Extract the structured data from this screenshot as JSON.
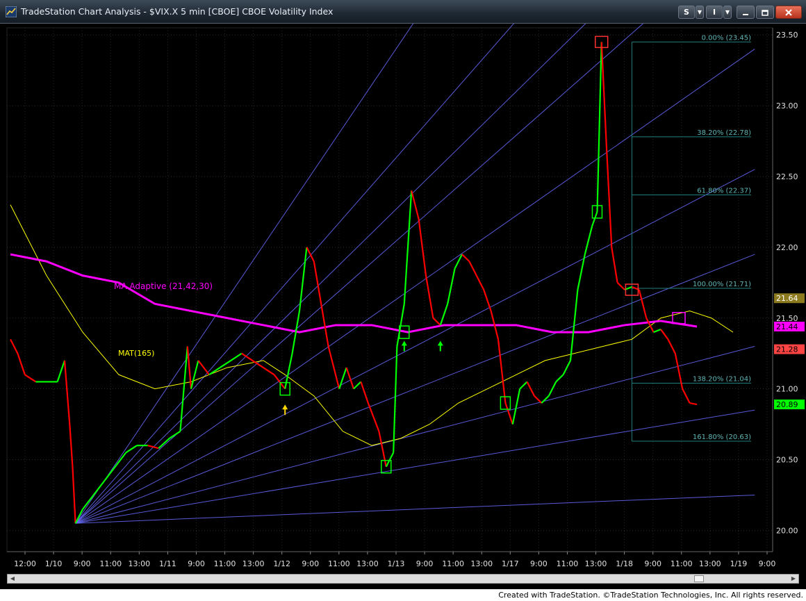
{
  "window": {
    "title": "TradeStation Chart Analysis - $VIX.X 5 min [CBOE] CBOE Volatility Index",
    "buttons": {
      "s_label": "S",
      "i_label": "I"
    },
    "icons": [
      "app-icon",
      "dropdown-arrow-icon",
      "minimize-icon",
      "restore-icon",
      "close-icon"
    ]
  },
  "footer": {
    "credit": "Created with TradeStation. ©TradeStation Technologies, Inc. All rights reserved."
  },
  "colors": {
    "bg": "#000000",
    "up": "#00ff00",
    "down": "#ff0000",
    "ma_adaptive": "#ff00ff",
    "mat": "#ffff00",
    "fan": "#6a6aff",
    "fib": "#1f7f7f"
  },
  "chart_data": {
    "type": "line",
    "symbol": "$VIX.X 5 min [CBOE]",
    "y_ticks": [
      "23.50",
      "23.00",
      "22.50",
      "22.00",
      "21.50",
      "21.00",
      "20.50",
      "20.00"
    ],
    "ylim": [
      19.85,
      23.55
    ],
    "x_ticks": [
      "12:00",
      "1/10",
      "9:00",
      "11:00",
      "13:00",
      "1/11",
      "9:00",
      "11:00",
      "13:00",
      "1/12",
      "9:00",
      "11:00",
      "13:00",
      "1/13",
      "9:00",
      "11:00",
      "13:00",
      "1/17",
      "9:00",
      "11:00",
      "13:00",
      "1/18",
      "9:00",
      "11:00",
      "13:00",
      "1/19",
      "9:00"
    ],
    "indicators": [
      {
        "name": "MA Adaptive (21,42,30)",
        "color": "#ff00ff",
        "last": "21.44"
      },
      {
        "name": "MAT(165)",
        "color": "#ffff00",
        "last": "21.64"
      }
    ],
    "price_labels": [
      {
        "value": "21.64",
        "bg": "#8c7a1e",
        "fg": "#ffffff"
      },
      {
        "value": "21.44",
        "bg": "#ff00ff",
        "fg": "#000000"
      },
      {
        "value": "21.28",
        "bg": "#ff4444",
        "fg": "#000000"
      },
      {
        "value": "20.89",
        "bg": "#00ff00",
        "fg": "#000000"
      }
    ],
    "fib_levels": [
      {
        "label": "0.00% (23.45)",
        "price": 23.45
      },
      {
        "label": "38.20% (22.78)",
        "price": 22.78
      },
      {
        "label": "61.80% (22.37)",
        "price": 22.37
      },
      {
        "label": "100.00% (21.71)",
        "price": 21.71
      },
      {
        "label": "138.20% (21.04)",
        "price": 21.04
      },
      {
        "label": "161.80% (20.63)",
        "price": 20.63
      }
    ],
    "price_path": [
      [
        0,
        21.35
      ],
      [
        0.01,
        21.25
      ],
      [
        0.02,
        21.1
      ],
      [
        0.035,
        21.05
      ],
      [
        0.05,
        21.05
      ],
      [
        0.065,
        21.05
      ],
      [
        0.075,
        21.2
      ],
      [
        0.082,
        20.75
      ],
      [
        0.086,
        20.45
      ],
      [
        0.09,
        20.05
      ],
      [
        0.1,
        20.15
      ],
      [
        0.115,
        20.25
      ],
      [
        0.13,
        20.35
      ],
      [
        0.145,
        20.45
      ],
      [
        0.16,
        20.55
      ],
      [
        0.175,
        20.6
      ],
      [
        0.19,
        20.6
      ],
      [
        0.205,
        20.58
      ],
      [
        0.22,
        20.65
      ],
      [
        0.235,
        20.7
      ],
      [
        0.245,
        21.3
      ],
      [
        0.25,
        21.0
      ],
      [
        0.26,
        21.2
      ],
      [
        0.275,
        21.1
      ],
      [
        0.29,
        21.15
      ],
      [
        0.305,
        21.2
      ],
      [
        0.32,
        21.25
      ],
      [
        0.335,
        21.2
      ],
      [
        0.35,
        21.15
      ],
      [
        0.365,
        21.1
      ],
      [
        0.38,
        21.0
      ],
      [
        0.39,
        21.25
      ],
      [
        0.4,
        21.55
      ],
      [
        0.41,
        22.0
      ],
      [
        0.42,
        21.9
      ],
      [
        0.43,
        21.6
      ],
      [
        0.44,
        21.3
      ],
      [
        0.455,
        21.0
      ],
      [
        0.465,
        21.15
      ],
      [
        0.475,
        21.0
      ],
      [
        0.485,
        21.05
      ],
      [
        0.495,
        20.9
      ],
      [
        0.51,
        20.7
      ],
      [
        0.52,
        20.45
      ],
      [
        0.53,
        20.55
      ],
      [
        0.535,
        21.3
      ],
      [
        0.545,
        21.6
      ],
      [
        0.555,
        22.4
      ],
      [
        0.565,
        22.2
      ],
      [
        0.575,
        21.8
      ],
      [
        0.585,
        21.5
      ],
      [
        0.595,
        21.45
      ],
      [
        0.605,
        21.6
      ],
      [
        0.615,
        21.85
      ],
      [
        0.625,
        21.95
      ],
      [
        0.635,
        21.9
      ],
      [
        0.645,
        21.8
      ],
      [
        0.655,
        21.7
      ],
      [
        0.665,
        21.55
      ],
      [
        0.675,
        21.35
      ],
      [
        0.685,
        20.9
      ],
      [
        0.695,
        20.75
      ],
      [
        0.705,
        21.0
      ],
      [
        0.715,
        21.05
      ],
      [
        0.725,
        20.95
      ],
      [
        0.735,
        20.9
      ],
      [
        0.745,
        20.95
      ],
      [
        0.755,
        21.05
      ],
      [
        0.765,
        21.1
      ],
      [
        0.775,
        21.2
      ],
      [
        0.785,
        21.7
      ],
      [
        0.795,
        21.95
      ],
      [
        0.805,
        22.15
      ],
      [
        0.812,
        22.25
      ],
      [
        0.818,
        23.45
      ],
      [
        0.825,
        22.7
      ],
      [
        0.832,
        22.0
      ],
      [
        0.84,
        21.75
      ],
      [
        0.85,
        21.7
      ],
      [
        0.86,
        21.72
      ],
      [
        0.87,
        21.7
      ],
      [
        0.88,
        21.5
      ],
      [
        0.89,
        21.4
      ],
      [
        0.9,
        21.42
      ],
      [
        0.91,
        21.35
      ],
      [
        0.92,
        21.25
      ],
      [
        0.93,
        21.0
      ],
      [
        0.94,
        20.9
      ],
      [
        0.95,
        20.89
      ]
    ],
    "mat_path": [
      [
        0,
        22.3
      ],
      [
        0.05,
        21.8
      ],
      [
        0.1,
        21.4
      ],
      [
        0.15,
        21.1
      ],
      [
        0.2,
        21.0
      ],
      [
        0.25,
        21.05
      ],
      [
        0.3,
        21.15
      ],
      [
        0.35,
        21.2
      ],
      [
        0.38,
        21.1
      ],
      [
        0.42,
        20.95
      ],
      [
        0.46,
        20.7
      ],
      [
        0.5,
        20.6
      ],
      [
        0.54,
        20.65
      ],
      [
        0.58,
        20.75
      ],
      [
        0.62,
        20.9
      ],
      [
        0.66,
        21.0
      ],
      [
        0.7,
        21.1
      ],
      [
        0.74,
        21.2
      ],
      [
        0.78,
        21.25
      ],
      [
        0.82,
        21.3
      ],
      [
        0.86,
        21.35
      ],
      [
        0.9,
        21.5
      ],
      [
        0.94,
        21.55
      ],
      [
        0.97,
        21.5
      ],
      [
        1.0,
        21.4
      ]
    ],
    "ma_adaptive_path": [
      [
        0,
        21.95
      ],
      [
        0.05,
        21.9
      ],
      [
        0.1,
        21.8
      ],
      [
        0.15,
        21.75
      ],
      [
        0.2,
        21.6
      ],
      [
        0.25,
        21.55
      ],
      [
        0.3,
        21.5
      ],
      [
        0.35,
        21.45
      ],
      [
        0.4,
        21.4
      ],
      [
        0.45,
        21.45
      ],
      [
        0.5,
        21.45
      ],
      [
        0.55,
        21.4
      ],
      [
        0.6,
        21.45
      ],
      [
        0.65,
        21.45
      ],
      [
        0.7,
        21.45
      ],
      [
        0.75,
        21.4
      ],
      [
        0.8,
        21.4
      ],
      [
        0.85,
        21.45
      ],
      [
        0.9,
        21.48
      ],
      [
        0.95,
        21.44
      ]
    ]
  }
}
